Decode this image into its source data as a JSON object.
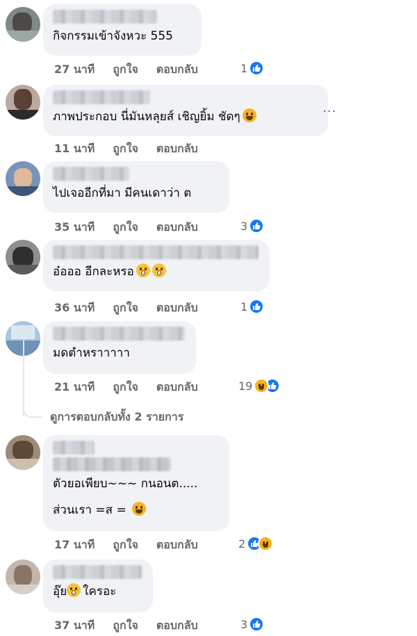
{
  "comments": [
    {
      "text": "กิจกรรมเข้าจังหวะ 555",
      "time": "27 นาที",
      "like": "ถูกใจ",
      "reply": "ตอบกลับ",
      "react_count": "1"
    },
    {
      "text": "ภาพประกอบ นี่มันหลุยส์ เชิญยิ้ม ชัดๆ",
      "time": "11 นาที",
      "like": "ถูกใจ",
      "reply": "ตอบกลับ",
      "react_count": ""
    },
    {
      "text": "ไปเจออีกที่มา มีคนเดาว่า ต",
      "time": "35 นาที",
      "like": "ถูกใจ",
      "reply": "ตอบกลับ",
      "react_count": "3"
    },
    {
      "text": "อ๋อออ อีกละหรอ",
      "time": "36 นาที",
      "like": "ถูกใจ",
      "reply": "ตอบกลับ",
      "react_count": "1"
    },
    {
      "text": "มดตำหราาาาา",
      "time": "21 นาที",
      "like": "ถูกใจ",
      "reply": "ตอบกลับ",
      "react_count": "19"
    },
    {
      "text": "ตัวยอเพียบ~~~ กนอนต.....",
      "text2": "ส่วนเรา =ส =",
      "time": "17 นาที",
      "like": "ถูกใจ",
      "reply": "ตอบกลับ",
      "react_count": "2"
    },
    {
      "text": "อุ๊ย",
      "text_after": "ใครอะ",
      "time": "37 นาที",
      "like": "ถูกใจ",
      "reply": "ตอบกลับ",
      "react_count": "3"
    }
  ],
  "more_button": "···",
  "view_replies": "ดูการตอบกลับทั้ง 2 รายการ",
  "icons": {
    "like_reaction": "thumbs-up-icon",
    "haha_reaction": "laughing-face-icon",
    "fear_emoji": "screaming-face-icon"
  },
  "colors": {
    "bubble": "#f0f2f5",
    "meta_text": "#65676b",
    "like_blue": "#1877f2",
    "emoji_yellow": "#f7b125"
  }
}
